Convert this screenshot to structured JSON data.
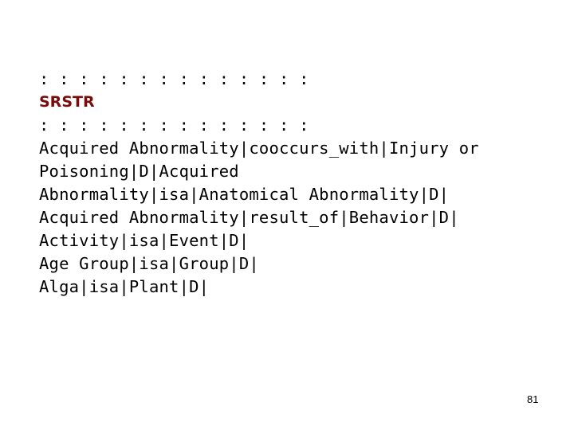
{
  "slide": {
    "separator_top": ": : : : : : : : : : : : : :",
    "heading": "SRSTR",
    "separator_bottom": ": : : : : : : : : : : : : :",
    "lines": [
      "Acquired Abnormality|cooccurs_with|Injury or",
      "Poisoning|D|Acquired",
      "Abnormality|isa|Anatomical Abnormality|D|",
      "Acquired Abnormality|result_of|Behavior|D|",
      "Activity|isa|Event|D|",
      "Age Group|isa|Group|D|",
      "Alga|isa|Plant|D|"
    ],
    "page_number": "81",
    "heading_color": "#7a0c0c"
  }
}
